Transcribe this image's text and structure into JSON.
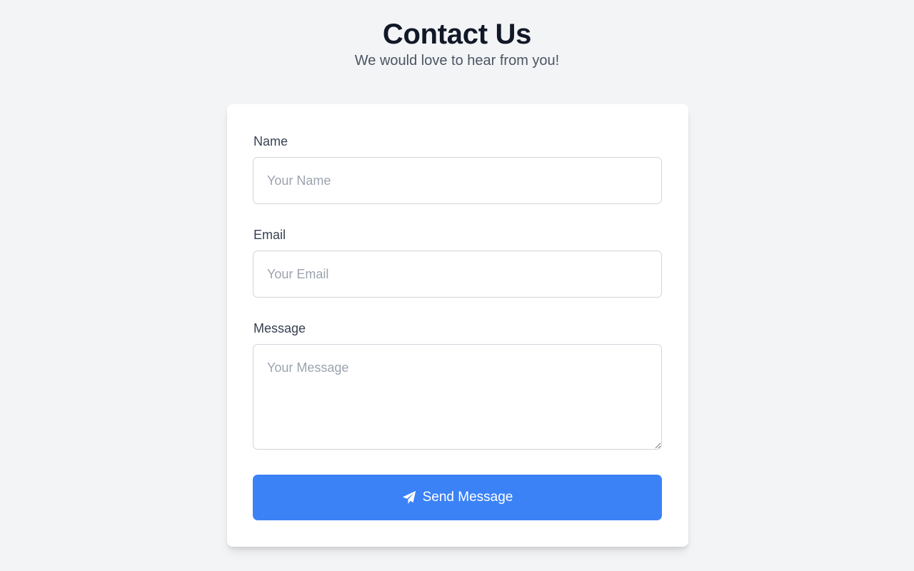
{
  "header": {
    "title": "Contact Us",
    "subtitle": "We would love to hear from you!"
  },
  "form": {
    "name": {
      "label": "Name",
      "placeholder": "Your Name",
      "value": ""
    },
    "email": {
      "label": "Email",
      "placeholder": "Your Email",
      "value": ""
    },
    "message": {
      "label": "Message",
      "placeholder": "Your Message",
      "value": ""
    },
    "submit": {
      "label": "Send Message",
      "icon": "paper-plane-icon"
    }
  },
  "colors": {
    "background": "#f3f4f6",
    "card": "#ffffff",
    "accent": "#3b82f6",
    "title": "#111827",
    "subtitle": "#4b5563",
    "placeholder": "#9ca3af",
    "border": "#d1d5db"
  }
}
